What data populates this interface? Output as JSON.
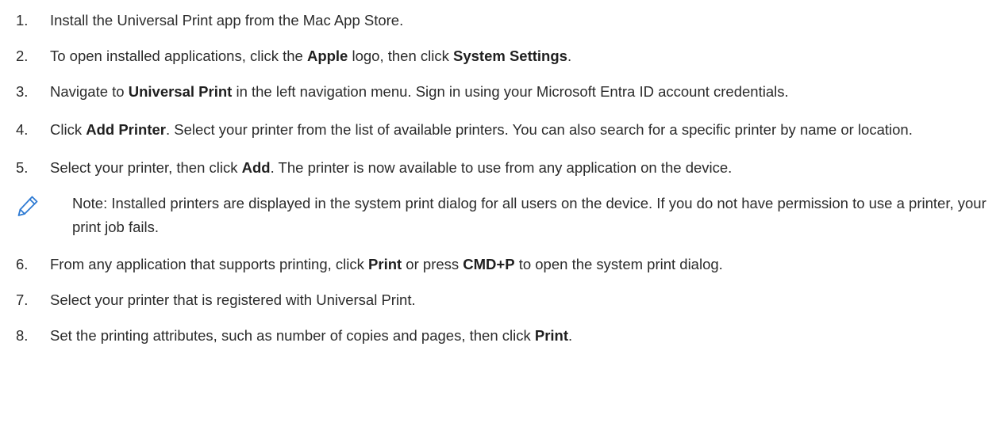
{
  "steps": [
    {
      "num": "1.",
      "parts": [
        {
          "t": "Install the Universal Print app from the Mac App Store."
        }
      ]
    },
    {
      "num": "2.",
      "parts": [
        {
          "t": "To open installed applications, click the "
        },
        {
          "t": "Apple",
          "b": true
        },
        {
          "t": " logo, then click "
        },
        {
          "t": "System Settings",
          "b": true
        },
        {
          "t": "."
        }
      ]
    },
    {
      "num": "3.",
      "parts": [
        {
          "t": "Navigate to "
        },
        {
          "t": "Universal Print",
          "b": true
        },
        {
          "t": " in the left navigation menu. Sign in using your Microsoft Entra ID account credentials."
        }
      ]
    },
    {
      "num": "4.",
      "parts": [
        {
          "t": "Click "
        },
        {
          "t": "Add Printer",
          "b": true
        },
        {
          "t": ". Select your printer from the list of available printers. You can also search for a specific printer by name or location."
        }
      ]
    },
    {
      "num": "5.",
      "parts": [
        {
          "t": "Select your printer, then click "
        },
        {
          "t": "Add",
          "b": true
        },
        {
          "t": ". The printer is now available to use from any application on the device."
        }
      ]
    }
  ],
  "note": {
    "icon": "pencil-note-icon",
    "icon_color": "#2f7bd3",
    "text": "Note: Installed printers are displayed in the system print dialog for all users on the device. If you do not have permission to use a printer, your print job fails."
  },
  "steps_after": [
    {
      "num": "6.",
      "parts": [
        {
          "t": "From any application that supports printing, click "
        },
        {
          "t": "Print",
          "b": true
        },
        {
          "t": " or press "
        },
        {
          "t": "CMD+P",
          "b": true
        },
        {
          "t": " to open the system print dialog."
        }
      ]
    },
    {
      "num": "7.",
      "parts": [
        {
          "t": "Select your printer that is registered with Universal Print."
        }
      ]
    },
    {
      "num": "8.",
      "parts": [
        {
          "t": "Set the printing attributes, such as number of copies and pages, then click "
        },
        {
          "t": "Print",
          "b": true
        },
        {
          "t": "."
        }
      ]
    }
  ]
}
